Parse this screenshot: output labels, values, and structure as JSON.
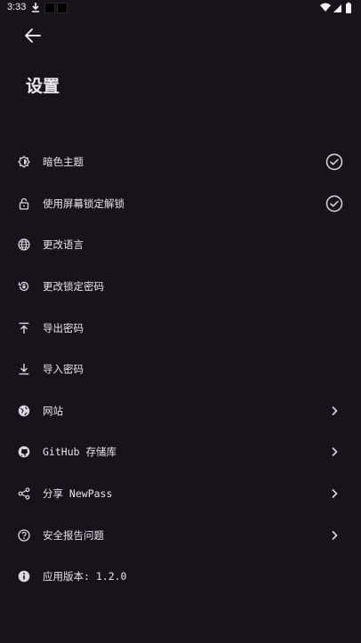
{
  "status_bar": {
    "time": "3:33"
  },
  "header": {
    "title": "设置"
  },
  "settings": {
    "dark_theme": "暗色主题",
    "screen_lock": "使用屏幕锁定解锁",
    "change_language": "更改语言",
    "change_password": "更改锁定密码",
    "export_password": "导出密码",
    "import_password": "导入密码",
    "website": "网站",
    "github": "GitHub 存储库",
    "share": "分享 NewPass",
    "report": "安全报告问题",
    "version": "应用版本:  1.2.0"
  },
  "colors": {
    "background": "#16131b",
    "text": "#e9e6ee",
    "icon": "#dcd8e2"
  }
}
